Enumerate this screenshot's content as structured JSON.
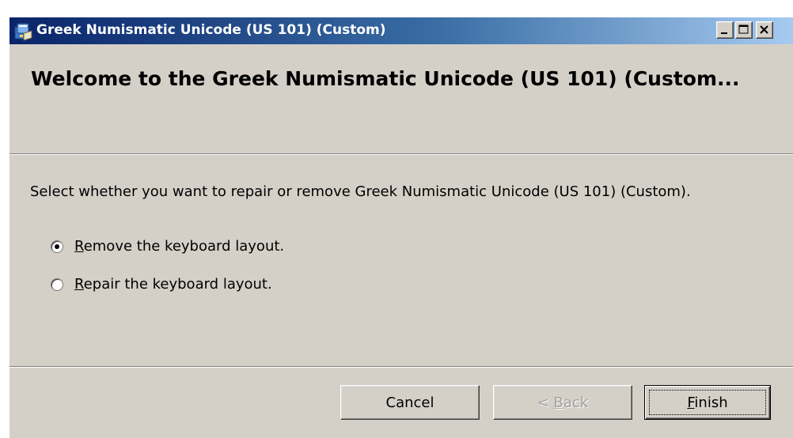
{
  "window": {
    "title": "Greek Numismatic Unicode (US 101) (Custom)",
    "icon": "installer-icon",
    "colors": {
      "titlebar_start": "#0a246a",
      "titlebar_end": "#a6caf0",
      "face": "#d4d0c8"
    }
  },
  "content": {
    "heading": "Welcome to the Greek Numismatic Unicode (US 101) (Custom...",
    "prompt": "Select whether you want to repair or remove Greek Numismatic Unicode (US 101) (Custom).",
    "options": [
      {
        "first_letter": "R",
        "rest": "emove the keyboard layout.",
        "selected": true
      },
      {
        "first_letter": "R",
        "rest": "epair the keyboard layout.",
        "selected": false
      }
    ]
  },
  "buttons": {
    "cancel": "Cancel",
    "back_prefix": "< ",
    "back_letter": "B",
    "back_rest": "ack",
    "back_enabled": false,
    "finish_letter": "F",
    "finish_rest": "inish"
  }
}
